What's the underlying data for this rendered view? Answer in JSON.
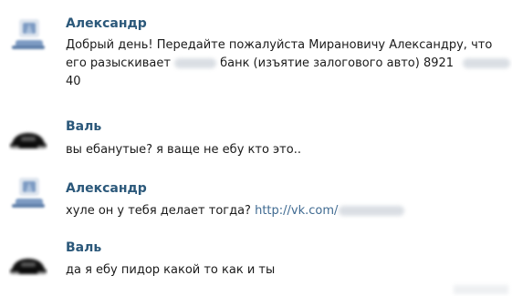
{
  "messages": [
    {
      "author": "Александр",
      "avatar": "alexander-avatar",
      "lines": [
        {
          "text": "Добрый день! Передайте пожалуйста Мирановичу Александру, что"
        },
        {
          "before": "его разыскивает ",
          "after": "банк (изъятие залогового авто) 8921",
          "redacted": true,
          "tail_redacted": true
        },
        {
          "text": "40"
        }
      ]
    },
    {
      "author": "Валь",
      "avatar": "val-avatar",
      "lines": [
        {
          "text": "вы ебанутые? я ваще не ебу кто это.."
        }
      ]
    },
    {
      "author": "Александр",
      "avatar": "alexander-avatar",
      "lines": [
        {
          "before": "хуле он у тебя делает тогда? ",
          "link": "http://vk.com/",
          "link_redacted": true
        }
      ]
    },
    {
      "author": "Валь",
      "avatar": "val-avatar",
      "lines": [
        {
          "text": "да я ебу пидор какой то как и ты"
        }
      ]
    }
  ],
  "colors": {
    "author": "#2b587a",
    "text": "#1a1a1a",
    "link": "#3f6a91",
    "alexander_avatar": "#7d9bc3",
    "val_avatar": "#111111"
  }
}
